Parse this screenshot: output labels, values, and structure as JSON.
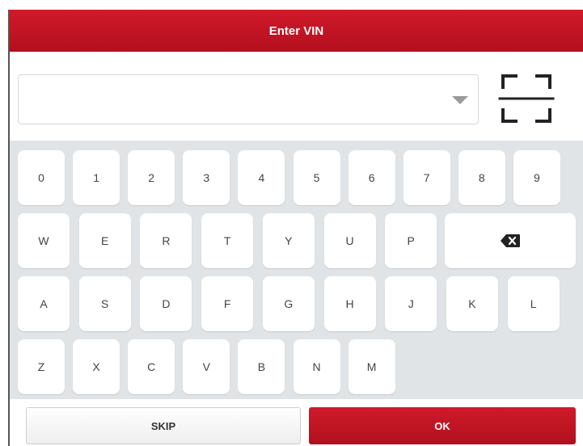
{
  "dialog": {
    "title": "Enter VIN"
  },
  "vin_input": {
    "value": "",
    "placeholder": ""
  },
  "icons": {
    "dropdown": "dropdown-arrow-icon",
    "scan": "scan-frame-icon",
    "backspace": "backspace-icon"
  },
  "keyboard": {
    "row1": [
      "0",
      "1",
      "2",
      "3",
      "4",
      "5",
      "6",
      "7",
      "8",
      "9"
    ],
    "row2": [
      "W",
      "E",
      "R",
      "T",
      "Y",
      "U",
      "P"
    ],
    "row3": [
      "A",
      "S",
      "D",
      "F",
      "G",
      "H",
      "J",
      "K",
      "L"
    ],
    "row4": [
      "Z",
      "X",
      "C",
      "V",
      "B",
      "N",
      "M"
    ]
  },
  "buttons": {
    "skip": "SKIP",
    "ok": "OK"
  },
  "colors": {
    "brand_red": "#c4142a",
    "keyboard_bg": "#e1e4e7",
    "key_bg": "#ffffff"
  }
}
